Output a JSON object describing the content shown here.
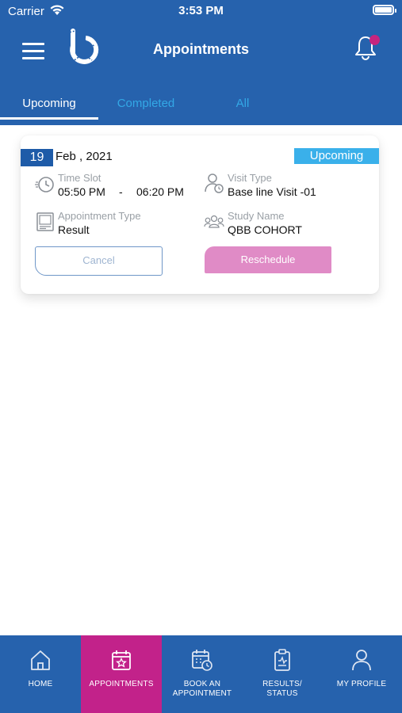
{
  "status_bar": {
    "carrier": "Carrier",
    "time": "3:53 PM"
  },
  "header": {
    "title": "Appointments",
    "has_notification_dot": true,
    "accent_color": "#2662ad"
  },
  "tabs": [
    {
      "label": "Upcoming",
      "active": true
    },
    {
      "label": "Completed",
      "active": false
    },
    {
      "label": "All",
      "active": false
    }
  ],
  "appointment": {
    "day": "19",
    "month_year": "Feb , 2021",
    "status": "Upcoming",
    "time_slot": {
      "label": "Time Slot",
      "start": "05:50 PM",
      "separator": "-",
      "end": "06:20 PM"
    },
    "visit_type": {
      "label": "Visit Type",
      "value": "Base line Visit -01"
    },
    "appointment_type": {
      "label": "Appointment Type",
      "value": "Result"
    },
    "study_name": {
      "label": "Study Name",
      "value": "QBB COHORT"
    },
    "cancel_label": "Cancel",
    "reschedule_label": "Reschedule"
  },
  "bottom_nav": [
    {
      "label": "HOME",
      "icon": "home-icon",
      "active": false
    },
    {
      "label": "APPOINTMENTS",
      "icon": "calendar-star-icon",
      "active": true
    },
    {
      "label": "BOOK AN APPOINTMENT",
      "icon": "calendar-clock-icon",
      "active": false
    },
    {
      "label": "RESULTS/ STATUS",
      "icon": "clipboard-icon",
      "active": false
    },
    {
      "label": "MY PROFILE",
      "icon": "user-icon",
      "active": false
    }
  ],
  "colors": {
    "brand_blue": "#2662ad",
    "active_nav": "#c2228a",
    "status_badge": "#3ab0ea",
    "reschedule": "#e08bc6",
    "tab_inactive": "#33a8e6"
  }
}
